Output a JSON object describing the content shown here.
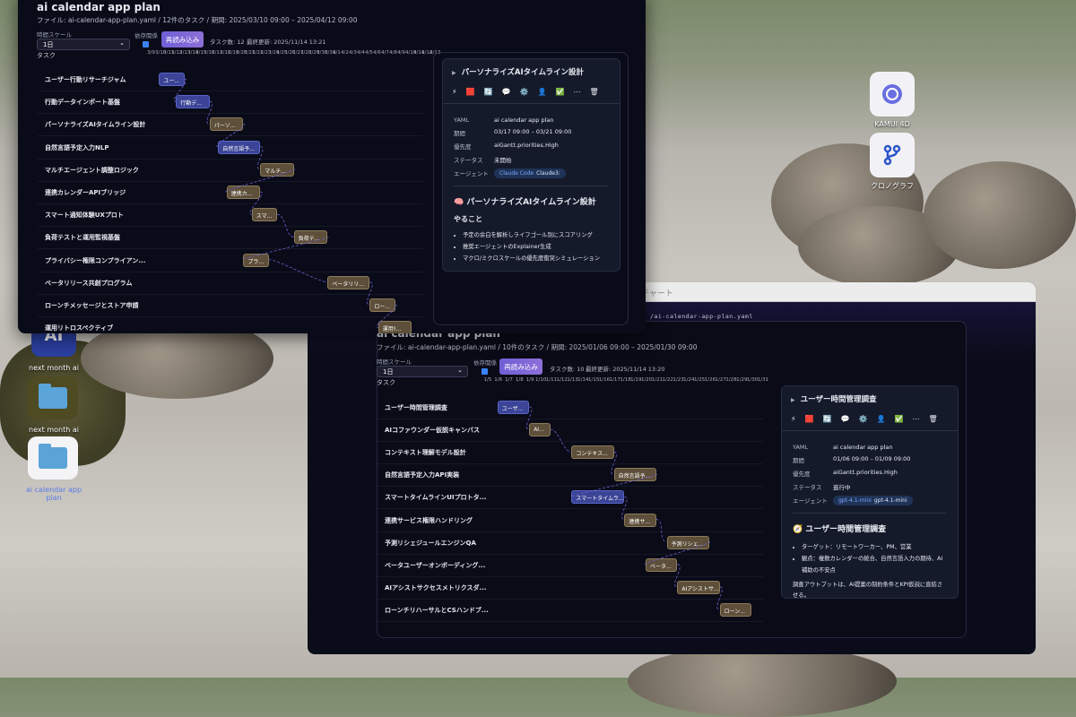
{
  "desktop": {
    "right_icons": [
      {
        "label": "KAMUI 4D",
        "icon": "kamui-app-icon"
      },
      {
        "label": "クロノグラフ",
        "icon": "branch-app-icon"
      }
    ],
    "left_icons": [
      {
        "label": "next month ai",
        "icon": "ai-app-icon"
      },
      {
        "label": "next month ai",
        "icon": "folder-icon"
      },
      {
        "label": "ai calendar app plan",
        "icon": "folder-icon"
      }
    ]
  },
  "window1": {
    "title": "ai calendar app plan",
    "subtitle": "ファイル: ai-calendar-app-plan.yaml / 12件のタスク / 期間: 2025/03/10 09:00 – 2025/04/12 09:00",
    "scale_label": "時間スケール",
    "scale_value": "1日",
    "deps_label": "依存関係",
    "reload_label": "再読み込み",
    "task_count": "タスク数: 12",
    "updated": "最終更新: 2025/11/14 13:21",
    "task_header": "タスク",
    "ticks": [
      "3/9",
      "3/10",
      "3/11",
      "3/12",
      "3/13",
      "3/14",
      "3/15",
      "3/16",
      "3/17",
      "3/18",
      "3/19",
      "3/20",
      "3/21",
      "3/22",
      "3/23",
      "3/24",
      "3/25",
      "3/26",
      "3/27",
      "3/28",
      "3/29",
      "3/30",
      "3/31",
      "4/1",
      "4/2",
      "4/3",
      "4/4",
      "4/5",
      "4/6",
      "4/7",
      "4/8",
      "4/9",
      "4/10",
      "4/11",
      "4/12",
      "4/13"
    ],
    "tasks": [
      {
        "name": "ユーザー行動リサーチジャム",
        "bar": "ユー...",
        "color": "blue",
        "start": 1,
        "days": 3
      },
      {
        "name": "行動データインポート基盤",
        "bar": "行動デ...",
        "color": "blue",
        "start": 3,
        "days": 4
      },
      {
        "name": "パーソナライズAIタイムライン設計",
        "bar": "パーソ...",
        "color": "brown",
        "start": 7,
        "days": 4
      },
      {
        "name": "自然言語予定入力NLP",
        "bar": "自然言語予...",
        "color": "blue",
        "start": 8,
        "days": 5
      },
      {
        "name": "マルチエージェント調整ロジック",
        "bar": "マルチ...",
        "color": "brown",
        "start": 13,
        "days": 4
      },
      {
        "name": "連携カレンダーAPIブリッジ",
        "bar": "連携カ...",
        "color": "brown",
        "start": 9,
        "days": 4
      },
      {
        "name": "スマート通知体験UXプロト",
        "bar": "スマ...",
        "color": "brown",
        "start": 12,
        "days": 3
      },
      {
        "name": "負荷テストと運用監視基盤",
        "bar": "負荷テ...",
        "color": "brown",
        "start": 17,
        "days": 4
      },
      {
        "name": "プライバシー権限コンプライアン...",
        "bar": "プラ...",
        "color": "brown",
        "start": 11,
        "days": 3
      },
      {
        "name": "ベータリリース共創プログラム",
        "bar": "ベータリリ...",
        "color": "brown",
        "start": 21,
        "days": 5
      },
      {
        "name": "ローンチメッセージとストア申請",
        "bar": "ロー...",
        "color": "brown",
        "start": 26,
        "days": 3
      },
      {
        "name": "運用リトロスペクティブ",
        "bar": "運用ﾘ...",
        "color": "brown",
        "start": 27,
        "days": 4
      }
    ],
    "detail": {
      "header": "パーソナライズAIタイムライン設計",
      "fields": [
        {
          "k": "YAML",
          "v": "ai calendar app plan"
        },
        {
          "k": "期間",
          "v": "03/17 09:00 – 03/21 09:00"
        },
        {
          "k": "優先度",
          "v": "aiGantt.priorities.High"
        },
        {
          "k": "ステータス",
          "v": "未開始"
        }
      ],
      "agent_label": "エージェント",
      "agent_name": "Claude Code",
      "agent_model": "Claude3:",
      "heading": "🧠 パーソナライズAIタイムライン設計",
      "subheading": "やること",
      "bullets": [
        "予定の余白を解析しライフゴール別にスコアリング",
        "推奨エージェントのExplainer生成",
        "マクロ/ミクロスケールの優先度衝突シミュレーション"
      ]
    }
  },
  "window2": {
    "window_title": "ガントチャート",
    "path": "/ai-calendar-app-plan.yaml",
    "title": "ai calendar app plan",
    "subtitle": "ファイル: ai-calendar-app-plan.yaml / 10件のタスク / 期間: 2025/01/06 09:00 – 2025/01/30 09:00",
    "scale_label": "時間スケール",
    "scale_value": "1日",
    "deps_label": "依存関係",
    "reload_label": "再読み込み",
    "task_count": "タスク数: 10",
    "updated": "最終更新: 2025/11/14 13:20",
    "task_header": "タスク",
    "ticks": [
      "1/5",
      "1/6",
      "1/7",
      "1/8",
      "1/9",
      "1/10",
      "1/11",
      "1/12",
      "1/13",
      "1/14",
      "1/15",
      "1/16",
      "1/17",
      "1/18",
      "1/19",
      "1/20",
      "1/21",
      "1/22",
      "1/23",
      "1/24",
      "1/25",
      "1/26",
      "1/27",
      "1/28",
      "1/29",
      "1/30",
      "1/31"
    ],
    "tasks": [
      {
        "name": "ユーザー時間管理調査",
        "bar": "ユーザ...",
        "color": "blue",
        "start": 1,
        "days": 3
      },
      {
        "name": "AIコファウンダー仮説キャンバス",
        "bar": "AI...",
        "color": "brown",
        "start": 4,
        "days": 2
      },
      {
        "name": "コンテキスト理解モデル設計",
        "bar": "コンテキス...",
        "color": "brown",
        "start": 8,
        "days": 4
      },
      {
        "name": "自然言語予定入力API実装",
        "bar": "自然言語予...",
        "color": "brown",
        "start": 12,
        "days": 4
      },
      {
        "name": "スマートタイムラインUIプロトタ...",
        "bar": "スマートタイムラ...",
        "color": "blue",
        "start": 8,
        "days": 5
      },
      {
        "name": "連携サービス権限ハンドリング",
        "bar": "連携サ...",
        "color": "brown",
        "start": 13,
        "days": 3
      },
      {
        "name": "予測リシェジュールエンジンQA",
        "bar": "予測リシェ...",
        "color": "brown",
        "start": 17,
        "days": 4
      },
      {
        "name": "ベータユーザーオンボーディング...",
        "bar": "ベータ...",
        "color": "brown",
        "start": 15,
        "days": 3
      },
      {
        "name": "AIアシストサクセスメトリクスダ...",
        "bar": "AIアシストサ...",
        "color": "brown",
        "start": 18,
        "days": 4
      },
      {
        "name": "ローンチリハーサルとCSハンドブ...",
        "bar": "ローン...",
        "color": "brown",
        "start": 22,
        "days": 3
      }
    ],
    "detail": {
      "header": "ユーザー時間管理調査",
      "fields": [
        {
          "k": "YAML",
          "v": "ai calendar app plan"
        },
        {
          "k": "期間",
          "v": "01/06 09:00 – 01/09 09:00"
        },
        {
          "k": "優先度",
          "v": "aiGantt.priorities.High"
        },
        {
          "k": "ステータス",
          "v": "進行中"
        }
      ],
      "agent_label": "エージェント",
      "agent_name": "gpt-4.1-mini",
      "agent_model": "gpt-4.1-mini",
      "heading": "🧭 ユーザー時間管理調査",
      "bullets": [
        "ターゲット：リモートワーカー、PM、営業",
        "観点：複数カレンダーの統合、自然言語入力の期待、AI補助の不安点"
      ],
      "paragraph": "調査アウトプットは、AI提案の制約条件とKPI仮説に直結させる。"
    }
  },
  "toolbar_icons": [
    {
      "g": "⚡",
      "name": "lightning-icon"
    },
    {
      "g": "🟥",
      "name": "stop-icon"
    },
    {
      "g": "🔄",
      "name": "refresh-icon"
    },
    {
      "g": "💬",
      "name": "comment-icon"
    },
    {
      "g": "⚙️",
      "name": "gear-icon"
    },
    {
      "g": "👤",
      "name": "user-icon"
    },
    {
      "g": "✅",
      "name": "check-icon"
    },
    {
      "g": "⋯",
      "name": "more-icon"
    },
    {
      "g": "🗑",
      "name": "trash-icon"
    }
  ]
}
